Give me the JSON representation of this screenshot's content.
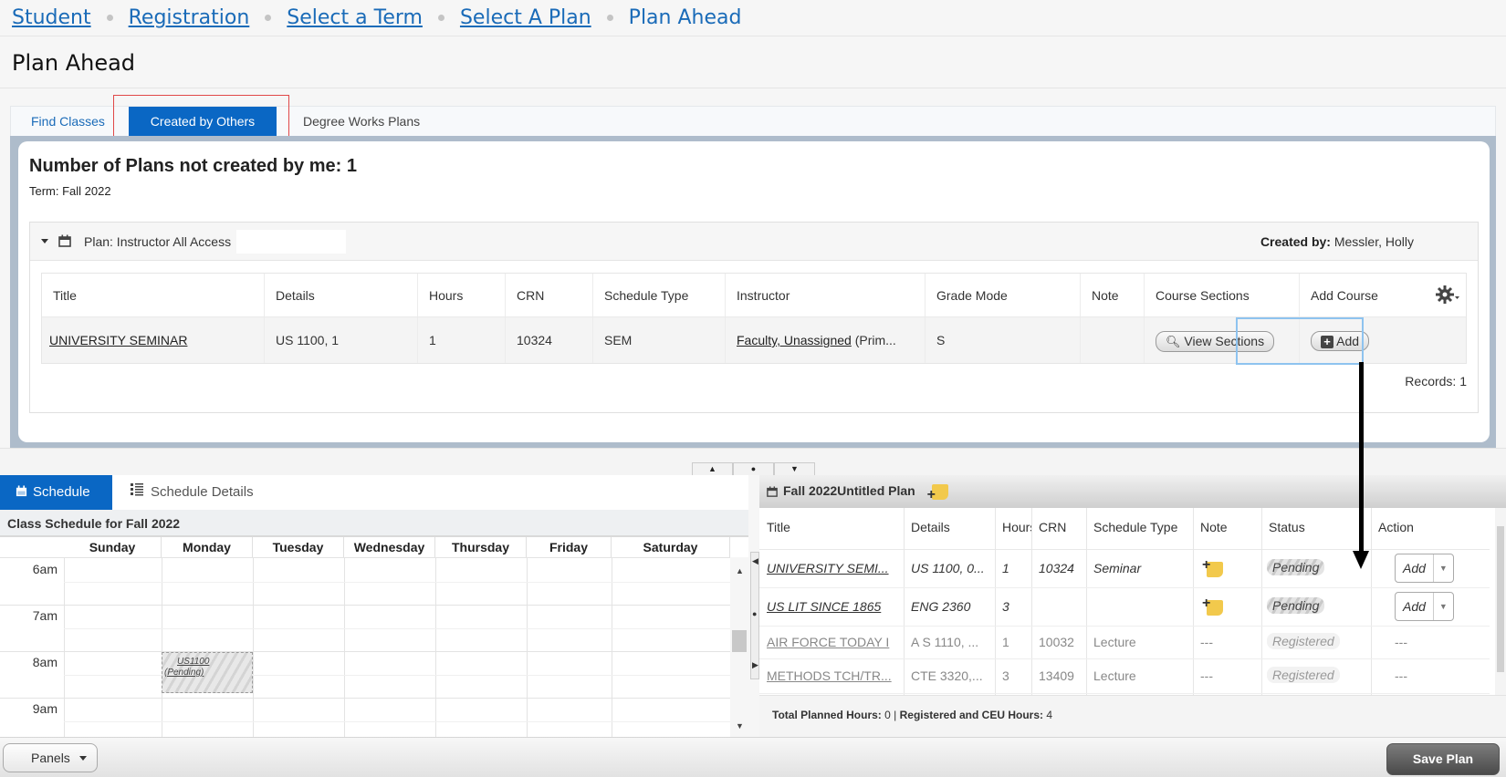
{
  "breadcrumb": {
    "items": [
      "Student",
      "Registration",
      "Select a Term",
      "Select A Plan"
    ],
    "current": "Plan Ahead"
  },
  "page_title": "Plan Ahead",
  "tabs": [
    {
      "label": "Find Classes",
      "active": false
    },
    {
      "label": "Created by Others",
      "active": true
    },
    {
      "label": "Degree Works Plans",
      "active": false
    }
  ],
  "plans_panel": {
    "heading": "Number of Plans not created by me: 1",
    "term": "Term: Fall 2022",
    "plan": {
      "name": "Plan: Instructor All Access",
      "created_by_label": "Created by:",
      "created_by_value": "Messler, Holly"
    },
    "columns": [
      "Title",
      "Details",
      "Hours",
      "CRN",
      "Schedule Type",
      "Instructor",
      "Grade Mode",
      "Note",
      "Course Sections",
      "Add Course"
    ],
    "rows": [
      {
        "title": "UNIVERSITY SEMINAR",
        "details": "US 1100, 1",
        "hours": "1",
        "crn": "10324",
        "schedule_type": "SEM",
        "instructor": "Faculty, Unassigned",
        "instructor_suffix": "(Prim...",
        "grade_mode": "S",
        "note": "",
        "view_sections_label": "View Sections",
        "add_label": "Add"
      }
    ],
    "records": "Records: 1"
  },
  "splitter": {
    "up": "▲",
    "mid": "●",
    "down": "▼"
  },
  "schedule": {
    "tabs": [
      {
        "label": "Schedule",
        "active": true
      },
      {
        "label": "Schedule Details",
        "active": false
      }
    ],
    "header": "Class Schedule for Fall 2022",
    "days": [
      "Sunday",
      "Monday",
      "Tuesday",
      "Wednesday",
      "Thursday",
      "Friday",
      "Saturday"
    ],
    "hours": [
      "6am",
      "7am",
      "8am",
      "9am"
    ],
    "event": {
      "course": "US1100",
      "status": "(Pending)",
      "day": "Monday",
      "start": "8am"
    }
  },
  "plan_panel": {
    "title": "Fall 2022Untitled Plan",
    "columns": [
      "Title",
      "Details",
      "Hours",
      "CRN",
      "Schedule Type",
      "Note",
      "Status",
      "Action"
    ],
    "rows": [
      {
        "title": "UNIVERSITY SEMI...",
        "details": "US 1100, 0...",
        "hours": "1",
        "crn": "10324",
        "schedule_type": "Seminar",
        "note": "add-note",
        "status": "Pending",
        "action": "Add"
      },
      {
        "title": "US LIT SINCE 1865",
        "details": "ENG 2360",
        "hours": "3",
        "crn": "",
        "schedule_type": "",
        "note": "add-note",
        "status": "Pending",
        "action": "Add"
      },
      {
        "title": "AIR FORCE TODAY I",
        "details": "A S 1110, ...",
        "hours": "1",
        "crn": "10032",
        "schedule_type": "Lecture",
        "note": "---",
        "status": "Registered",
        "action": "---"
      },
      {
        "title": "METHODS TCH/TR...",
        "details": "CTE 3320,...",
        "hours": "3",
        "crn": "13409",
        "schedule_type": "Lecture",
        "note": "---",
        "status": "Registered",
        "action": "---"
      }
    ],
    "totals": {
      "planned_label": "Total Planned Hours:",
      "planned_value": "0",
      "registered_label": "Registered and CEU Hours:",
      "registered_value": "4"
    }
  },
  "footer": {
    "panels_label": "Panels",
    "save_label": "Save Plan"
  },
  "colors": {
    "accent": "#0a67c4",
    "link": "#1a6bb8",
    "highlight_box": "#e04848",
    "selection_border": "#8ec3ef"
  }
}
